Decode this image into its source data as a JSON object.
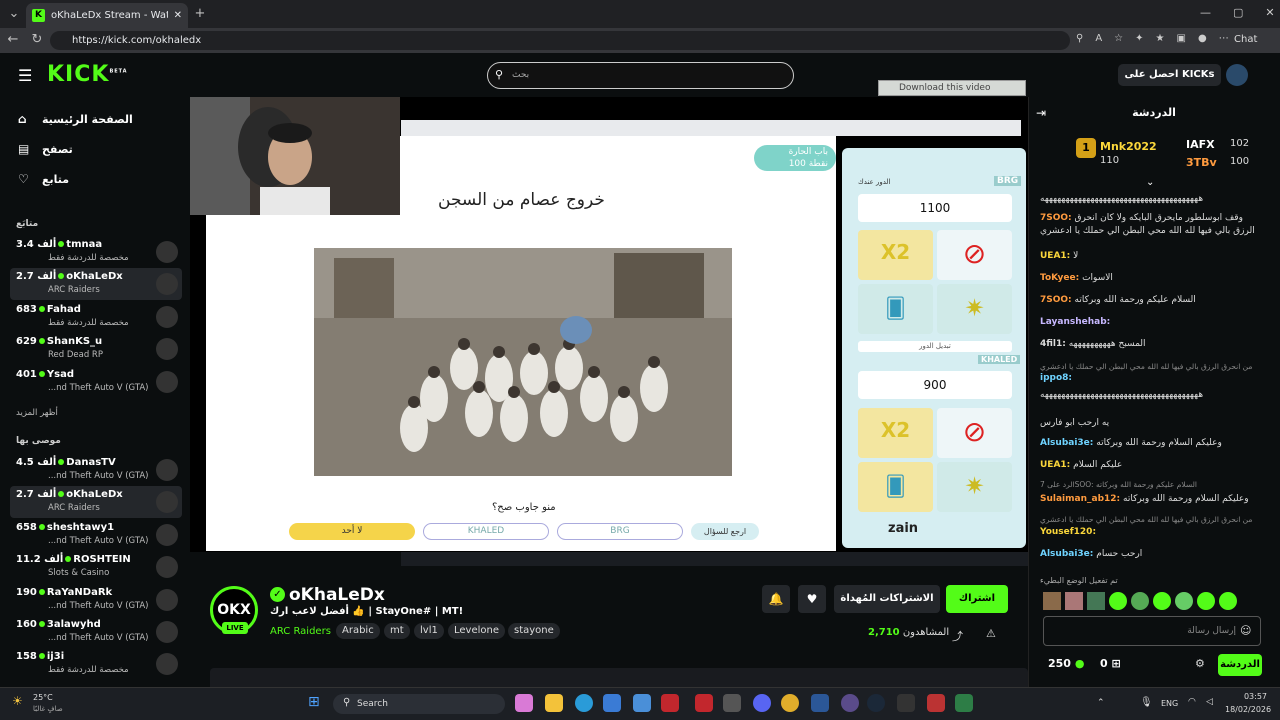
{
  "browser": {
    "tab_title": "oKhaLeDx Stream - Watch Live on",
    "url": "https://kick.com/okhaledx",
    "chat_button": "Chat"
  },
  "header": {
    "logo": "KICK",
    "logo_beta": "BETA",
    "search_placeholder": "بحث",
    "get_kicks": "احصل على KICKs"
  },
  "overlay": {
    "download_video": "Download this video"
  },
  "sidebar": {
    "nav": [
      {
        "label": "الصفحة الرئيسية",
        "icon": "home-icon"
      },
      {
        "label": "تصفح",
        "icon": "browse-icon"
      },
      {
        "label": "متابع",
        "icon": "heart-icon"
      }
    ],
    "following_title": "متابَع",
    "following": [
      {
        "viewers": "3.4 ألف",
        "name": "tmnaa",
        "category": "مخصصة للدردشة فقط"
      },
      {
        "viewers": "2.7 ألف",
        "name": "oKhaLeDx",
        "category": "ARC Raiders"
      },
      {
        "viewers": "683",
        "name": "Fahad",
        "category": "مخصصة للدردشة فقط"
      },
      {
        "viewers": "629",
        "name": "ShanKS_u",
        "category": "Red Dead RP"
      },
      {
        "viewers": "401",
        "name": "Ysad",
        "category": "...nd Theft Auto V (GTA)"
      }
    ],
    "show_more": "أظهر المزيد",
    "recommended_title": "موصى بها",
    "recommended": [
      {
        "viewers": "4.5 ألف",
        "name": "DanasTV",
        "category": "...nd Theft Auto V (GTA)"
      },
      {
        "viewers": "2.7 ألف",
        "name": "oKhaLeDx",
        "category": "ARC Raiders"
      },
      {
        "viewers": "658",
        "name": "sheshtawy1",
        "category": "...nd Theft Auto V (GTA)"
      },
      {
        "viewers": "11.2 ألف",
        "name": "ROSHTEIN",
        "category": "Slots & Casino"
      },
      {
        "viewers": "190",
        "name": "RaYaNDaRk",
        "category": "...nd Theft Auto V (GTA)"
      },
      {
        "viewers": "160",
        "name": "3alawyhd",
        "category": "...nd Theft Auto V (GTA)"
      },
      {
        "viewers": "158",
        "name": "ij3i",
        "category": "مخصصة للدردشة فقط"
      }
    ]
  },
  "stream_screen": {
    "question_title": "خروج عصام من السجن",
    "badge_line1": "باب الحارة",
    "badge_line2": "100 نقطة",
    "prompt": "منو جاوب صح؟",
    "answers": [
      "لا أحد",
      "KHALED",
      "BRG"
    ],
    "back_btn": "ارجع للسؤال",
    "team1": "BRG",
    "team1_score": "1100",
    "team2": "KHALED",
    "team2_score": "900",
    "turn_label": "الدور عندك",
    "switch_turn": "تبديل الدور",
    "powerups": [
      "دبل سكور",
      "منع الخصم",
      "بوق السؤال",
      "الحظ"
    ],
    "sponsor": "zain"
  },
  "channel": {
    "name": "oKhaLeDx",
    "live": "LIVE",
    "title": "أفضل لاعب ارك 👍 | StayOne# | MT!",
    "category": "ARC Raiders",
    "tags": [
      "Arabic",
      "mt",
      "lvl1",
      "Levelone",
      "stayone"
    ],
    "subscribe": "اشتراك",
    "gift_subs": "الاشتراكات المُهداة",
    "viewers_label": "المشاهدون",
    "viewers": "2,710"
  },
  "chat": {
    "title": "الدردشة",
    "leaderboard": [
      {
        "name": "Mnk2022",
        "value": "110"
      },
      {
        "name": "IAFX",
        "value": "102"
      },
      {
        "name": "3TBv",
        "value": "100"
      }
    ],
    "messages": [
      {
        "user": "",
        "text": "ههههههههههههههههههههههههههههههههههههههه",
        "color": "#ddd"
      },
      {
        "user": "7SOO:",
        "text": "وقف ابوسلطور مايحرق البايكه ولا كان انحرق الرزق بالي فيها لله الله محي البطن الي حملك يا ادعشري",
        "color": "#ff9b3f"
      },
      {
        "user": "UEA1:",
        "text": "لا",
        "color": "#fbd73b"
      },
      {
        "user": "ToKyee:",
        "text": "الاسوات",
        "color": "#ff9b3f"
      },
      {
        "user": "7SOO:",
        "text": "السلام عليكم ورحمة الله وبركاته",
        "color": "#ff9b3f"
      },
      {
        "user": "Layanshehab:",
        "text": "",
        "color": "#c7b8ff"
      },
      {
        "user": "4fil1:",
        "text": "المسبح ههههههههههه",
        "color": "#ddd"
      },
      {
        "user": "ippo8:",
        "text": "",
        "color": "#6fd3ff"
      },
      {
        "user": "",
        "text": "ههههههههههههههههههههههههههههههههههههههه",
        "color": "#ddd"
      },
      {
        "user": "",
        "text": "يه ارحب ابو فارس",
        "color": "#ddd"
      },
      {
        "user": "Alsubai3e:",
        "text": "وعليكم السلام ورحمة الله وبركاته",
        "color": "#6fd3ff"
      },
      {
        "user": "UEA1:",
        "text": "عليكم السلام",
        "color": "#fbd73b"
      },
      {
        "user": "Sulaiman_ab12:",
        "text": "وعليكم السلام ورحمة الله وبركاته",
        "color": "#ff9b3f"
      },
      {
        "user": "Yousef120:",
        "text": "",
        "color": "#fbd73b"
      },
      {
        "user": "Alsubai3e:",
        "text": "ارحب حسام",
        "color": "#6fd3ff"
      }
    ],
    "replies": [
      "من انحرق الرزق بالي فيها لله الله محي البطن الي حملك يا ادعشري",
      "الرد على 7SOO: السلام عليكم ورحمة الله وبركاته",
      "من انحرق الرزق بالي فيها لله الله محي البطن الي حملك يا ادعشري",
      "من انحرق الرزق بالي فيها لله الله محي البطن الي حملك يا ادعشري"
    ],
    "slow_mode": "تم تفعيل الوضع البطيء",
    "input_placeholder": "إرسال رسالة",
    "points": "250",
    "count": "0",
    "send": "الدردشة"
  },
  "os": {
    "weather_temp": "25°C",
    "weather_desc": "صافٍ غالبًا",
    "search": "Search",
    "lang": "ENG",
    "time": "03:57",
    "date": "18/02/2026"
  }
}
